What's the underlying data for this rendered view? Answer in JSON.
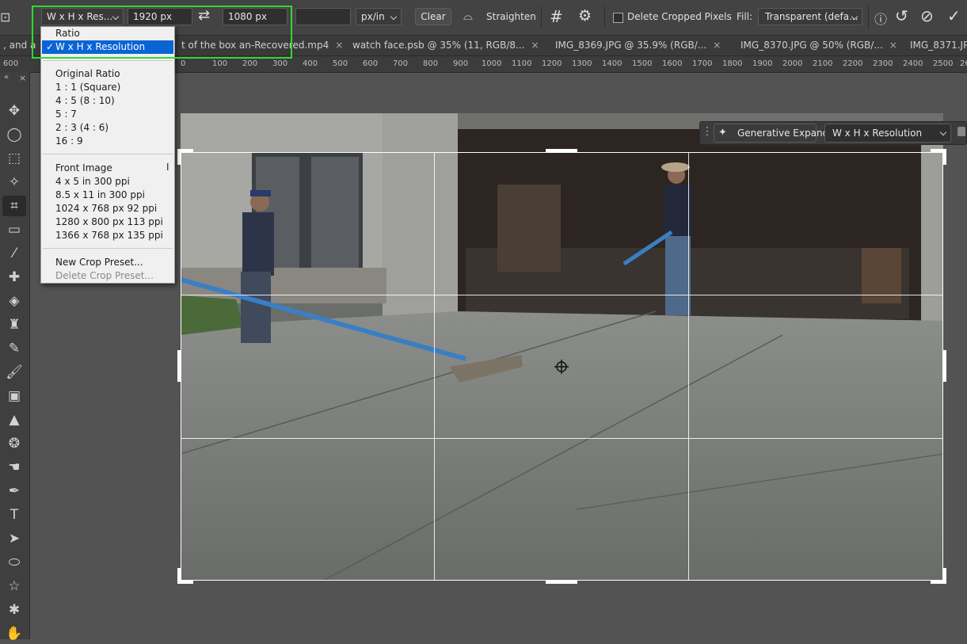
{
  "options_bar": {
    "preset_label": "W x H x Res...",
    "width_value": "1920 px",
    "height_value": "1080 px",
    "resolution_value": "",
    "units_value": "px/in",
    "clear_label": "Clear",
    "straighten_label": "Straighten",
    "delete_cropped_label": "Delete Cropped Pixels",
    "fill_label": "Fill:",
    "fill_value": "Transparent (defa..."
  },
  "tabs": [
    {
      "label": ", and a j"
    },
    {
      "label": "t of the box an-Recovered.mp4"
    },
    {
      "label": "watch face.psb @ 35% (11, RGB/8..."
    },
    {
      "label": "IMG_8369.JPG @ 35.9% (RGB/..."
    },
    {
      "label": "IMG_8370.JPG @ 50% (RGB/..."
    },
    {
      "label": "IMG_8371.JP"
    }
  ],
  "ruler_ticks": [
    "600",
    "0",
    "100",
    "200",
    "300",
    "400",
    "500",
    "600",
    "700",
    "800",
    "900",
    "1000",
    "1100",
    "1200",
    "1300",
    "1400",
    "1500",
    "1600",
    "1700",
    "1800",
    "1900",
    "2000",
    "2100",
    "2200",
    "2300",
    "2400",
    "2500",
    "26"
  ],
  "dropdown": {
    "items": [
      {
        "label": "Ratio",
        "selected": false
      },
      {
        "label": "W x H x Resolution",
        "selected": true
      },
      {
        "label": "Original Ratio"
      },
      {
        "label": "1 : 1 (Square)"
      },
      {
        "label": "4 : 5 (8 : 10)"
      },
      {
        "label": "5 : 7"
      },
      {
        "label": "2 : 3 (4 : 6)"
      },
      {
        "label": "16 : 9"
      },
      {
        "label": "Front Image"
      },
      {
        "label": "4 x 5 in 300 ppi"
      },
      {
        "label": "8.5 x 11 in 300 ppi"
      },
      {
        "label": "1024 x 768 px 92 ppi"
      },
      {
        "label": "1280 x 800 px 113 ppi"
      },
      {
        "label": "1366 x 768 px 135 ppi"
      },
      {
        "label": "New Crop Preset..."
      },
      {
        "label": "Delete Crop Preset...",
        "disabled": true
      }
    ],
    "checkmark": "✓",
    "cursor_glyph": "I"
  },
  "gen_bar": {
    "expand_label": "Generative Expand",
    "preset_value": "W x H x Resolution"
  },
  "colors": {
    "highlight_box": "#30d830",
    "selected_item_bg": "#0a64d4"
  },
  "icons": {
    "toolbar": [
      "move-icon",
      "marquee-ellipse-icon",
      "object-select-icon",
      "magic-wand-icon",
      "crop-icon",
      "ruler-icon",
      "eyedropper-icon",
      "healing-brush-icon",
      "patch-icon",
      "stamp-icon",
      "brush-icon",
      "paintbrush-icon",
      "gradient-icon",
      "triangle-icon",
      "sponge-icon",
      "smudge-icon",
      "pen-icon",
      "type-icon",
      "path-select-icon",
      "ellipse-icon",
      "star-icon",
      "custom-shape-icon",
      "hand-icon"
    ]
  }
}
